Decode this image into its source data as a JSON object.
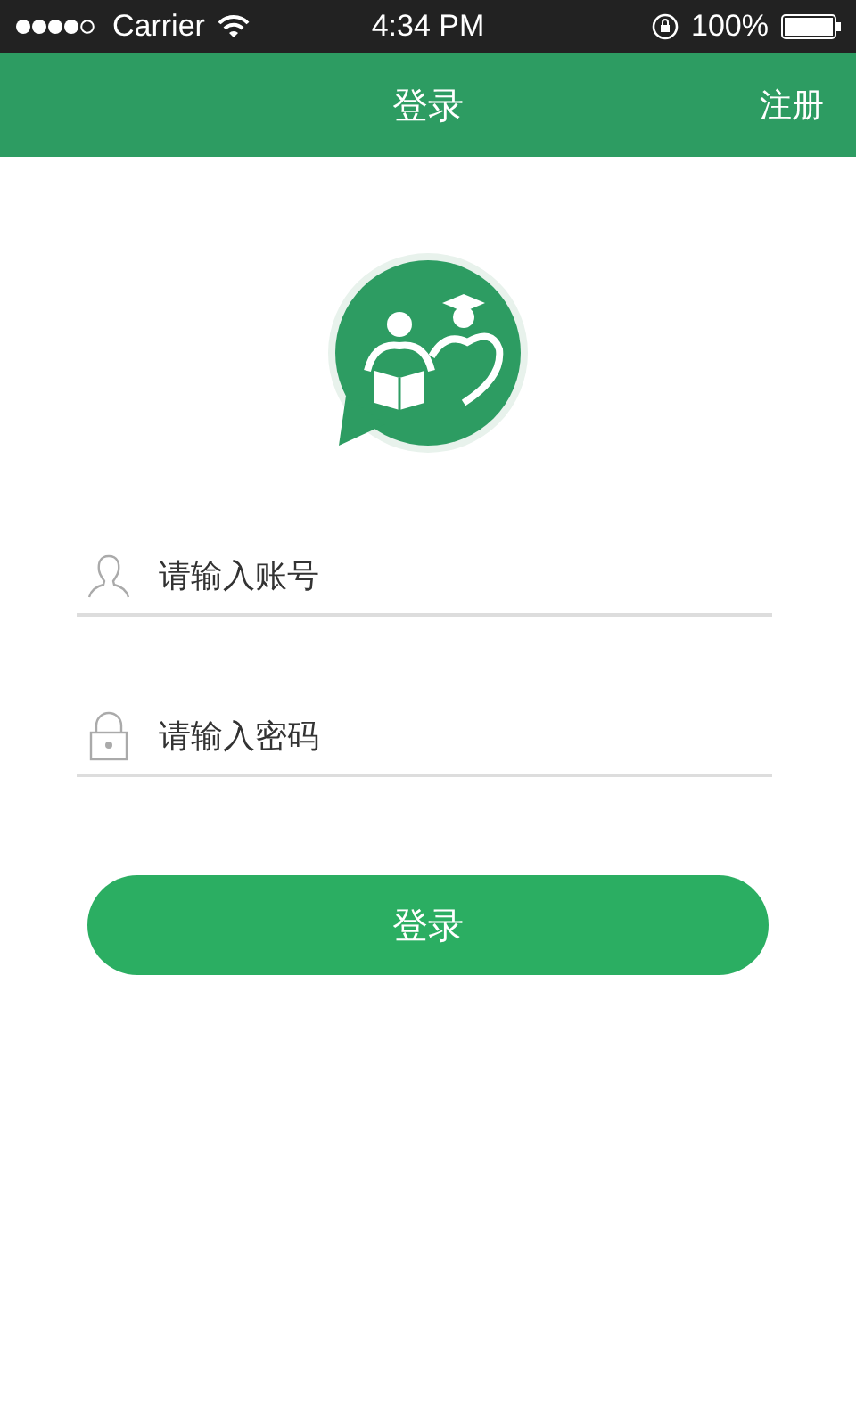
{
  "status_bar": {
    "carrier": "Carrier",
    "time": "4:34 PM",
    "battery": "100%"
  },
  "nav_bar": {
    "title": "登录",
    "action": "注册"
  },
  "fields": [
    {
      "kind": "account",
      "placeholder": "请输入账号"
    },
    {
      "kind": "password",
      "placeholder": "请输入密码"
    }
  ],
  "buttons": [
    "登录"
  ]
}
